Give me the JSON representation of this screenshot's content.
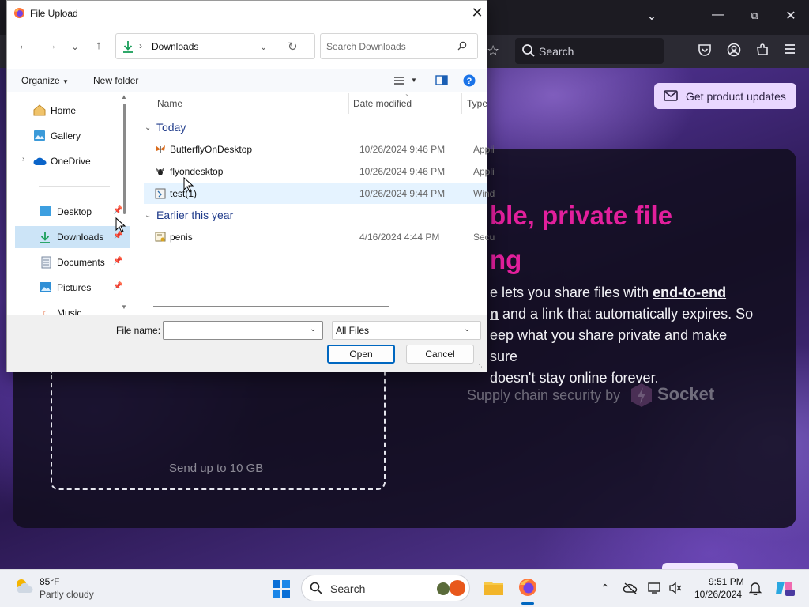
{
  "browser": {
    "search_placeholder": "Search",
    "updates_button": "Get product updates",
    "hero_title": "ble, private file ng",
    "hero_title_line1": "ble, private file",
    "hero_title_line2": "ng",
    "hero_body_1": "e lets you share files with ",
    "hero_body_bold1": "end-to-end",
    "hero_body_2": "n",
    "hero_body_3": " and a link that automatically expires. So",
    "hero_body_4": "eep what you share private and make sure",
    "hero_body_5": "doesn't stay online forever.",
    "supply_text": "Supply chain security by",
    "socket_text": "Socket",
    "send_text": "Send up to 10 GB"
  },
  "dialog": {
    "title": "File Upload",
    "address": "Downloads",
    "search_placeholder": "Search Downloads",
    "organize": "Organize",
    "new_folder": "New folder",
    "nav_items": [
      {
        "label": "Home"
      },
      {
        "label": "Gallery"
      },
      {
        "label": "OneDrive"
      },
      {
        "label": "Desktop"
      },
      {
        "label": "Downloads"
      },
      {
        "label": "Documents"
      },
      {
        "label": "Pictures"
      },
      {
        "label": "Music"
      }
    ],
    "columns": {
      "name": "Name",
      "date": "Date modified",
      "type": "Type"
    },
    "groups": [
      {
        "label": "Today"
      },
      {
        "label": "Earlier this year"
      }
    ],
    "files": [
      {
        "name": "ButterflyOnDesktop",
        "date": "10/26/2024 9:46 PM",
        "type": "Appli"
      },
      {
        "name": "flyondesktop",
        "date": "10/26/2024 9:46 PM",
        "type": "Appli"
      },
      {
        "name": "test(1)",
        "date": "10/26/2024 9:44 PM",
        "type": "Wind"
      },
      {
        "name": "penis",
        "date": "4/16/2024 4:44 PM",
        "type": "Secu"
      }
    ],
    "file_name_label": "File name:",
    "file_name_value": "",
    "filter": "All Files",
    "open_button": "Open",
    "cancel_button": "Cancel"
  },
  "taskbar": {
    "temperature": "85°F",
    "condition": "Partly cloudy",
    "search_placeholder": "Search",
    "time": "9:51 PM",
    "date": "10/26/2024"
  },
  "colors": {
    "accent": "#0067c0",
    "hero_pink": "#e21f9c",
    "selection": "#cce4f7"
  }
}
